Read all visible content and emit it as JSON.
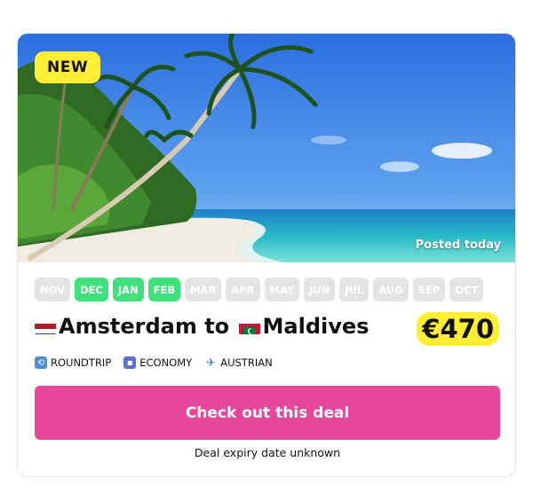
{
  "badge": "NEW",
  "posted": "Posted today",
  "months": [
    {
      "label": "NOV",
      "active": false
    },
    {
      "label": "DEC",
      "active": true
    },
    {
      "label": "JAN",
      "active": true
    },
    {
      "label": "FEB",
      "active": true
    },
    {
      "label": "MAR",
      "active": false
    },
    {
      "label": "APR",
      "active": false
    },
    {
      "label": "MAY",
      "active": false
    },
    {
      "label": "JUN",
      "active": false
    },
    {
      "label": "JUL",
      "active": false
    },
    {
      "label": "AUG",
      "active": false
    },
    {
      "label": "SEP",
      "active": false
    },
    {
      "label": "OCT",
      "active": false
    }
  ],
  "route": {
    "origin": "Amsterdam",
    "connector": " to ",
    "destination": "Maldives",
    "origin_flag": "netherlands-flag",
    "destination_flag": "maldives-flag"
  },
  "price": "€470",
  "meta": {
    "trip": "ROUNDTRIP",
    "cabin": "ECONOMY",
    "airline": "AUSTRIAN"
  },
  "cta": "Check out this deal",
  "expiry": "Deal expiry date unknown",
  "colors": {
    "accent": "#e6479b",
    "active_month": "#3fe17b",
    "inactive_month": "#e4e4e4",
    "highlight": "#ffee33"
  }
}
